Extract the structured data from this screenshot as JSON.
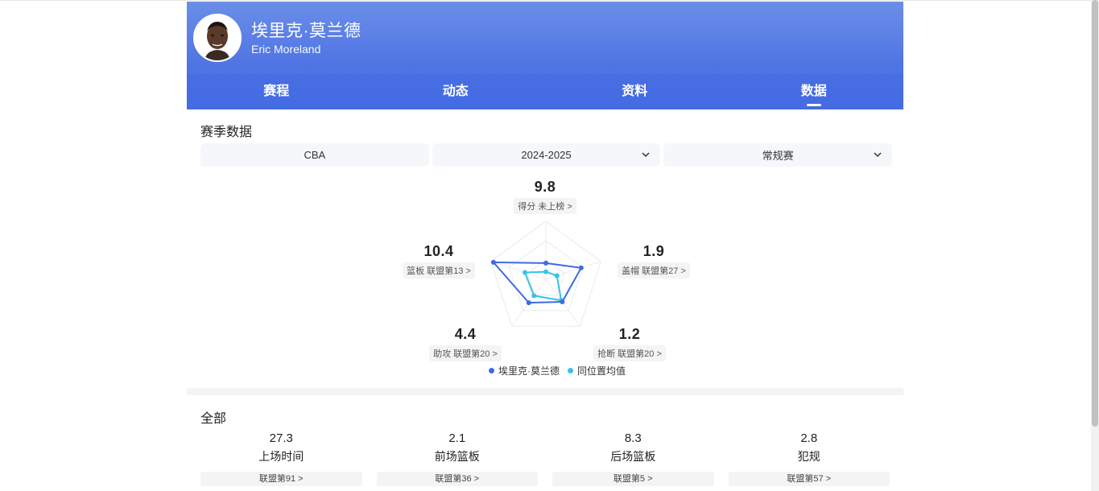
{
  "player": {
    "name_cn": "埃里克·莫兰德",
    "name_en": "Eric Moreland"
  },
  "tabs": [
    {
      "label": "赛程",
      "active": false
    },
    {
      "label": "动态",
      "active": false
    },
    {
      "label": "资料",
      "active": false
    },
    {
      "label": "数据",
      "active": true
    }
  ],
  "season": {
    "title": "赛季数据",
    "league": "CBA",
    "year": "2024-2025",
    "stage": "常规赛"
  },
  "radar": {
    "stats": [
      {
        "key": "points",
        "value": "9.8",
        "rank": "得分 未上榜 >"
      },
      {
        "key": "blocks",
        "value": "1.9",
        "rank": "盖帽 联盟第27 >"
      },
      {
        "key": "steals",
        "value": "1.2",
        "rank": "抢断 联盟第20 >"
      },
      {
        "key": "assists",
        "value": "4.4",
        "rank": "助攻 联盟第20 >"
      },
      {
        "key": "rebounds",
        "value": "10.4",
        "rank": "篮板 联盟第13 >"
      }
    ],
    "player_levels": [
      0.28,
      0.64,
      0.48,
      0.5,
      0.95
    ],
    "average_levels": [
      0.13,
      0.2,
      0.45,
      0.35,
      0.38
    ],
    "legend": {
      "player": "埃里克·莫兰德",
      "average": "同位置均值"
    },
    "colors": {
      "player": "#3d6ae6",
      "average": "#36c3e6"
    }
  },
  "all": {
    "title": "全部",
    "items": [
      {
        "value": "27.3",
        "label": "上场时间",
        "rank": "联盟第91 >"
      },
      {
        "value": "2.1",
        "label": "前场篮板",
        "rank": "联盟第36 >"
      },
      {
        "value": "8.3",
        "label": "后场篮板",
        "rank": "联盟第5 >"
      },
      {
        "value": "2.8",
        "label": "犯规",
        "rank": "联盟第57 >"
      }
    ]
  }
}
